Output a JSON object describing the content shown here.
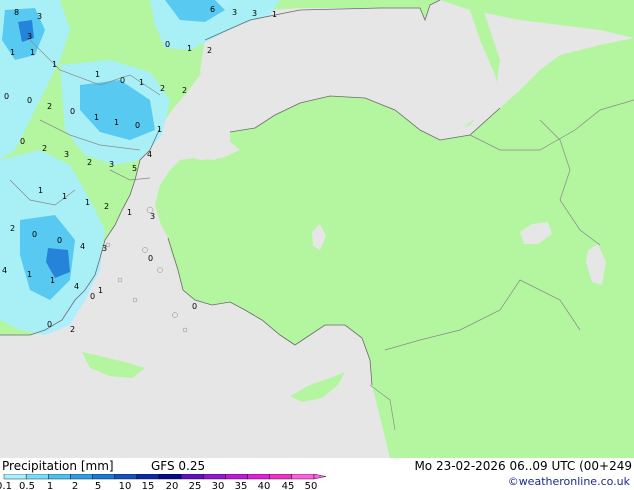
{
  "footer": {
    "title": "Precipitation [mm]",
    "model": "GFS 0.25",
    "valid_time": "Mo 23-02-2026 06..09 UTC (00+249",
    "credit": "©weatheronline.co.uk"
  },
  "legend": {
    "ticks": [
      "0.1",
      "0.5",
      "1",
      "2",
      "5",
      "10",
      "15",
      "20",
      "25",
      "30",
      "35",
      "40",
      "45",
      "50"
    ],
    "colors": [
      "#a6f0ff",
      "#78dcfa",
      "#4ac2f0",
      "#2ca0e6",
      "#1c78d6",
      "#1450c0",
      "#0c28a8",
      "#080a8c",
      "#6010c0",
      "#9018d0",
      "#c018d8",
      "#e020d8",
      "#f030c8",
      "#ff60e0"
    ]
  },
  "map": {
    "land_color": "#b4f5a0",
    "sea_color": "#e6e6e6",
    "border_color": "#888888",
    "precip_labels": [
      "8",
      "3",
      "6",
      "3",
      "3",
      "1",
      "3",
      "1",
      "1",
      "0",
      "1",
      "2",
      "1",
      "1",
      "0",
      "1",
      "2",
      "2",
      "0",
      "0",
      "2",
      "0",
      "1",
      "1",
      "0",
      "1",
      "0",
      "2",
      "3",
      "2",
      "3",
      "5",
      "4",
      "1",
      "1",
      "1",
      "2",
      "1",
      "3",
      "2",
      "0",
      "0",
      "4",
      "3",
      "0",
      "4",
      "1",
      "1",
      "4",
      "1",
      "0",
      "0",
      "2",
      "0"
    ]
  }
}
